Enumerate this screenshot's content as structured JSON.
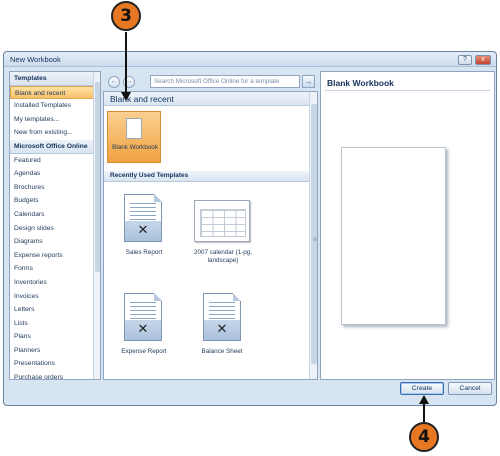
{
  "window": {
    "title": "New Workbook"
  },
  "titlebar_buttons": {
    "help": "?",
    "minimize": "–",
    "close": "x"
  },
  "callouts": {
    "top": "3",
    "bottom": "4"
  },
  "nav": {
    "back": "←",
    "forward": "→"
  },
  "search": {
    "placeholder": "Search Microsoft Office Online for a template",
    "go": "→"
  },
  "sidebar": {
    "items": [
      {
        "label": "Templates",
        "kind": "header"
      },
      {
        "label": "Blank and recent",
        "kind": "selected"
      },
      {
        "label": "Installed Templates",
        "kind": "item"
      },
      {
        "label": "My templates...",
        "kind": "item"
      },
      {
        "label": "New from existing...",
        "kind": "item"
      },
      {
        "label": "Microsoft Office Online",
        "kind": "header"
      },
      {
        "label": "Featured",
        "kind": "item"
      },
      {
        "label": "Agendas",
        "kind": "item"
      },
      {
        "label": "Brochures",
        "kind": "item"
      },
      {
        "label": "Budgets",
        "kind": "item"
      },
      {
        "label": "Calendars",
        "kind": "item"
      },
      {
        "label": "Design slides",
        "kind": "item"
      },
      {
        "label": "Diagrams",
        "kind": "item"
      },
      {
        "label": "Expense reports",
        "kind": "item"
      },
      {
        "label": "Forms",
        "kind": "item"
      },
      {
        "label": "Inventories",
        "kind": "item"
      },
      {
        "label": "Invoices",
        "kind": "item"
      },
      {
        "label": "Letters",
        "kind": "item"
      },
      {
        "label": "Lists",
        "kind": "item"
      },
      {
        "label": "Plans",
        "kind": "item"
      },
      {
        "label": "Planners",
        "kind": "item"
      },
      {
        "label": "Presentations",
        "kind": "item"
      },
      {
        "label": "Purchase orders",
        "kind": "item"
      }
    ]
  },
  "main": {
    "section_title": "Blank and recent",
    "blank_tile_label": "Blank Workbook",
    "recent_header": "Recently Used Templates",
    "templates": [
      {
        "label": "Sales Report"
      },
      {
        "label_line1": "2007 calendar (1-pg,",
        "label_line2": "landscape)"
      },
      {
        "label": "Expense Report"
      },
      {
        "label": "Balance Sheet"
      }
    ]
  },
  "preview": {
    "title": "Blank Workbook"
  },
  "buttons": {
    "create": "Create",
    "cancel": "Cancel"
  },
  "splitter_grip": "≡",
  "colors": {
    "accent_callout": "#e87722",
    "selection": "#f8c06a",
    "dialog_bg": "#d7e4f2"
  }
}
